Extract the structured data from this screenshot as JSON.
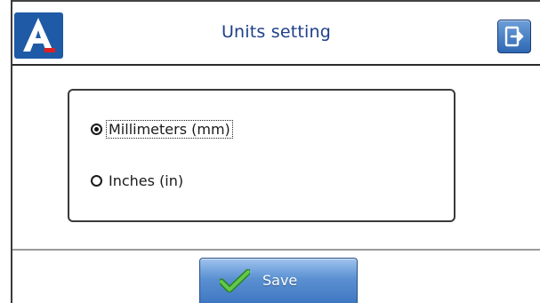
{
  "header": {
    "title": "Units setting",
    "logo_icon": "app-logo-letter-a",
    "exit_icon": "exit-door-icon"
  },
  "units": {
    "options": [
      {
        "label": "Millimeters (mm)",
        "selected": true
      },
      {
        "label": "Inches (in)",
        "selected": false
      }
    ]
  },
  "footer": {
    "save_label": "Save",
    "save_icon": "checkmark-icon"
  },
  "colors": {
    "title_text": "#1d3f8a",
    "logo_bg": "#1f5aa6",
    "logo_accent": "#e02020",
    "button_blue": "#3f78c2",
    "check_green": "#3aa52b"
  }
}
